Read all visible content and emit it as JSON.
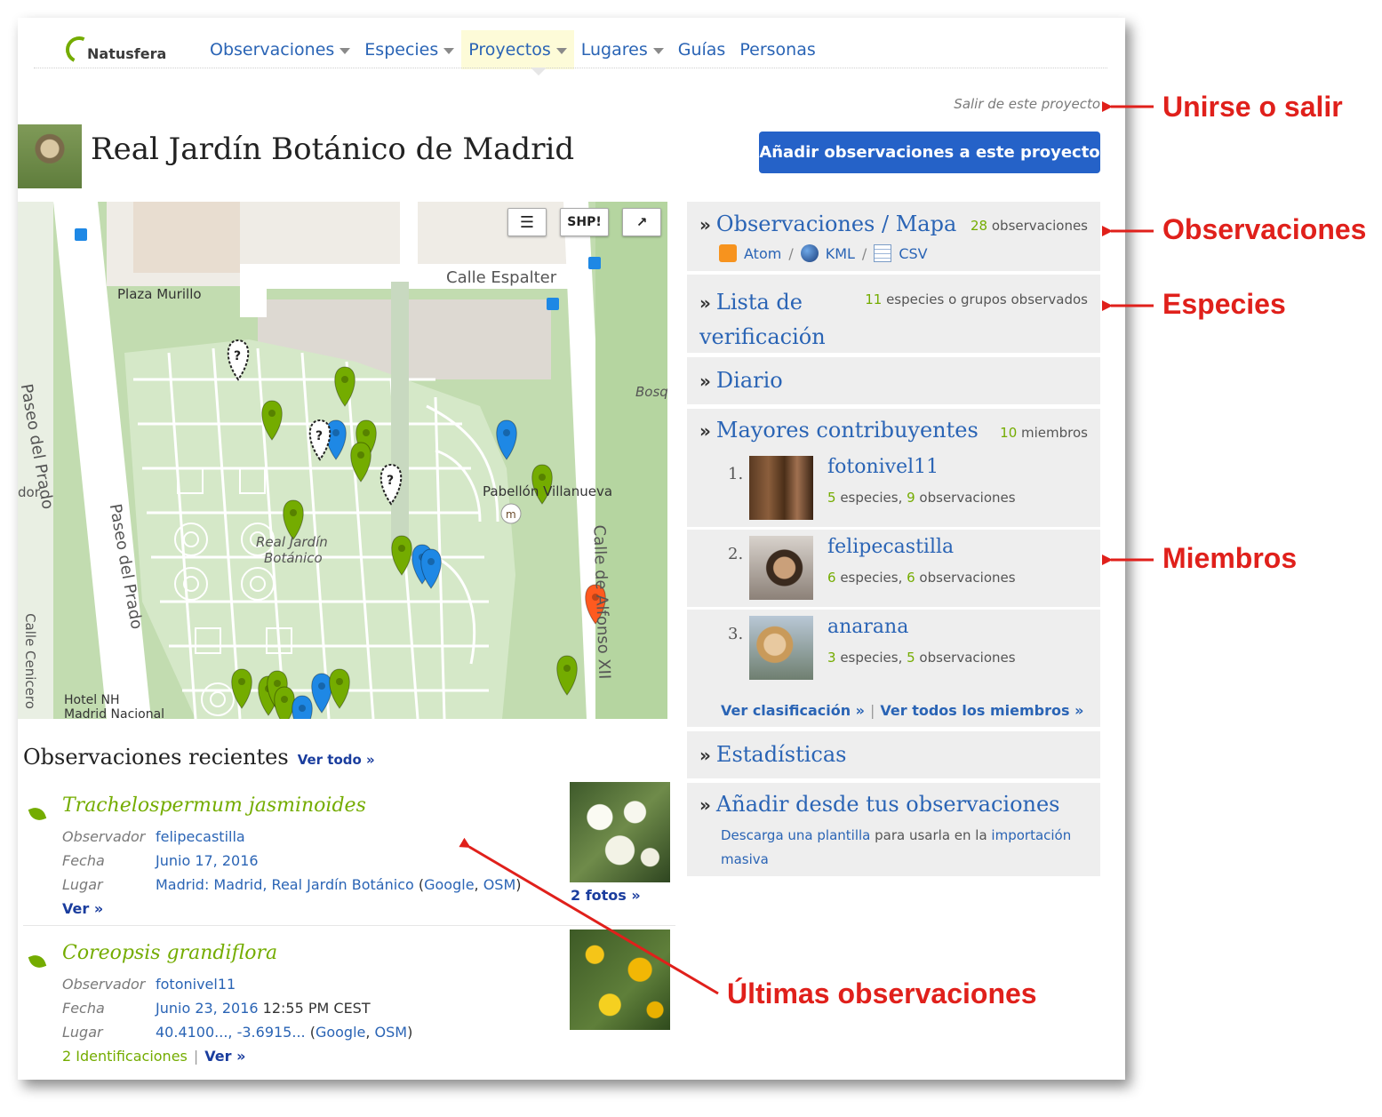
{
  "header": {
    "logo_text_a": "Natu",
    "logo_text_b": "sfera",
    "nav": [
      {
        "label": "Observaciones",
        "caret": true
      },
      {
        "label": "Especies",
        "caret": true
      },
      {
        "label": "Proyectos",
        "caret": true,
        "active": true
      },
      {
        "label": "Lugares",
        "caret": true
      },
      {
        "label": "Guías",
        "caret": false
      },
      {
        "label": "Personas",
        "caret": false
      }
    ]
  },
  "project": {
    "leave_link": "Salir de este proyecto",
    "title": "Real Jardín Botánico de Madrid",
    "add_button": "Añadir observaciones a este proyecto"
  },
  "map": {
    "buttons": {
      "layers": "layers-icon",
      "shp": "SHP!",
      "expand": "external-link-icon"
    },
    "labels": {
      "plaza": "Plaza Murillo",
      "espalter": "Calle Espalter",
      "paseo_left": "Paseo del Prado",
      "paseo_mid": "Paseo del Prado",
      "garden_1": "Real Jardín",
      "garden_2": "Botánico",
      "pabellon": "Pabellón Villanueva",
      "alfonso": "Calle de Alfonso XII",
      "bosq": "Bosq",
      "dor": "dor",
      "cenicero": "Calle Cenicero",
      "hotel_1": "Hotel NH",
      "hotel_2": "Madrid Nacional"
    },
    "marker_colors": {
      "green": "#74ac00",
      "blue": "#1e88e5",
      "red": "#ff5a1f",
      "unknown": "#ffffff"
    }
  },
  "recent": {
    "heading": "Observaciones recientes",
    "see_all": "Ver todo »",
    "items": [
      {
        "species": "Trachelospermum jasminoides",
        "observer_label": "Observador",
        "observer": "felipecastilla",
        "date_label": "Fecha",
        "date": "Junio 17, 2016",
        "date_extra": "",
        "place_label": "Lugar",
        "place": "Madrid: Madrid, Real Jardín Botánico",
        "place_p1": " (",
        "google": "Google",
        "comma": ", ",
        "osm": "OSM",
        "place_p2": ")",
        "ids": "",
        "view": "Ver »",
        "photos": "2 fotos »"
      },
      {
        "species": "Coreopsis grandiflora",
        "observer_label": "Observador",
        "observer": "fotonivel11",
        "date_label": "Fecha",
        "date": "Junio 23, 2016",
        "date_extra": " 12:55 PM CEST",
        "place_label": "Lugar",
        "place": "40.4100..., -3.6915...",
        "place_p1": " (",
        "google": "Google",
        "comma": ", ",
        "osm": "OSM",
        "place_p2": ")",
        "ids": "2 Identificaciones",
        "view": "Ver »",
        "photos": ""
      }
    ]
  },
  "sidebar": {
    "observations": {
      "title": "Observaciones / Mapa",
      "count": "28",
      "count_label": " observaciones",
      "atom": "Atom",
      "kml": "KML",
      "csv": "CSV",
      "slash": "/"
    },
    "checklist": {
      "title_1": "Lista de",
      "title_2": "verificación",
      "count": "11",
      "count_label": " especies o grupos observados"
    },
    "journal": {
      "title": "Diario"
    },
    "contributors": {
      "title": "Mayores contribuyentes",
      "count": "10",
      "count_label": " miembros",
      "members": [
        {
          "rank": "1.",
          "name": "fotonivel11",
          "species": "5",
          "species_label": " especies, ",
          "obs": "9",
          "obs_label": " observaciones"
        },
        {
          "rank": "2.",
          "name": "felipecastilla",
          "species": "6",
          "species_label": " especies, ",
          "obs": "6",
          "obs_label": " observaciones"
        },
        {
          "rank": "3.",
          "name": "anarana",
          "species": "3",
          "species_label": " especies, ",
          "obs": "5",
          "obs_label": " observaciones"
        }
      ],
      "ranking_link": "Ver clasificación »",
      "sep": "|",
      "all_members_link": "Ver todos los miembros »"
    },
    "stats": {
      "title": "Estadísticas"
    },
    "add_from": {
      "title": "Añadir desde tus observaciones",
      "link_1": "Descarga una plantilla",
      "text_1": " para usarla en la ",
      "link_2": "importación masiva"
    }
  },
  "annotations": {
    "join": "Unirse o salir",
    "observations": "Observaciones",
    "species": "Especies",
    "members": "Miembros",
    "latest": "Últimas observaciones",
    "color": "#e0201b"
  }
}
